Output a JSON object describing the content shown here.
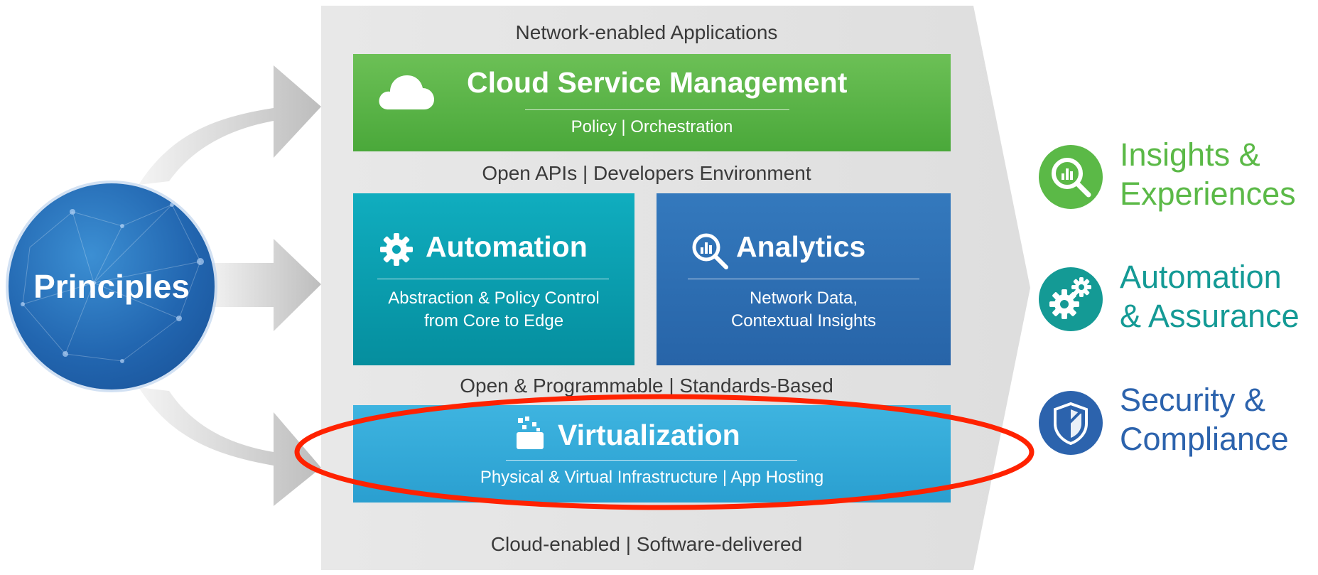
{
  "principles": {
    "label": "Principles"
  },
  "stack": {
    "top_label": "Network-enabled Applications",
    "cloud": {
      "title": "Cloud Service Management",
      "subtitle": "Policy | Orchestration",
      "icon": "cloud-icon"
    },
    "api_label": "Open APIs | Developers Environment",
    "automation": {
      "title": "Automation",
      "line1": "Abstraction & Policy Control",
      "line2": "from Core to Edge",
      "icon": "gear-icon"
    },
    "analytics": {
      "title": "Analytics",
      "line1": "Network Data,",
      "line2": "Contextual Insights",
      "icon": "magnifier-chart-icon"
    },
    "open_label": "Open & Programmable | Standards-Based",
    "virtualization": {
      "title": "Virtualization",
      "subtitle": "Physical & Virtual Infrastructure | App Hosting",
      "icon": "cubes-icon"
    },
    "bottom_label": "Cloud-enabled | Software-delivered"
  },
  "outcomes": [
    {
      "line1": "Insights &",
      "line2": "Experiences",
      "color": "#5bb947",
      "icon": "insights-magnifier-icon"
    },
    {
      "line1": "Automation",
      "line2": "& Assurance",
      "color": "#149a95",
      "icon": "gears-icon"
    },
    {
      "line1": "Security &",
      "line2": "Compliance",
      "color": "#2c63ad",
      "icon": "shield-icon"
    }
  ],
  "colors": {
    "cloud_green": "#5cb649",
    "automation_teal": "#0aa3b4",
    "analytics_blue": "#2e70b4",
    "virtualization_blue": "#36abd9",
    "highlight_red": "#ff2200",
    "panel_gray": "#e6e6e6"
  }
}
